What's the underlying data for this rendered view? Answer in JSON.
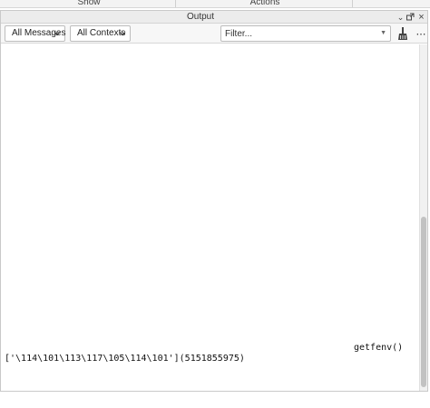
{
  "top_tabs": {
    "show_label": "Show",
    "actions_label": "Actions"
  },
  "panel": {
    "title": "Output"
  },
  "toolbar": {
    "messages_filter": {
      "selected": "All Messages"
    },
    "contexts_filter": {
      "selected": "All Contexts"
    },
    "search": {
      "placeholder": "Filter...",
      "value": ""
    },
    "clear_icon": "broom-icon",
    "more_icon": "more-horizontal-icon"
  },
  "output": {
    "lines": [
      "getfenv()",
      "['\\114\\101\\113\\117\\105\\114\\101'](5151855975)"
    ]
  },
  "colors": {
    "toolbar_bg": "#f7f7f7",
    "titlebar_bg": "#ececec",
    "text": "#111111"
  }
}
